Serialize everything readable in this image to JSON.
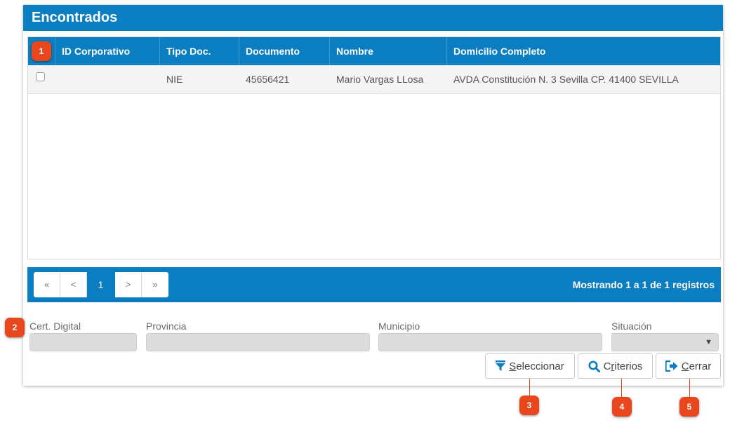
{
  "panel": {
    "title": "Encontrados"
  },
  "table": {
    "columns": [
      "ID Corporativo",
      "Tipo Doc.",
      "Documento",
      "Nombre",
      "Domicilio Completo"
    ],
    "rows": [
      {
        "id_corporativo": "",
        "tipo_doc": "NIE",
        "documento": "45656421",
        "nombre": "Mario Vargas LLosa",
        "domicilio": "AVDA Constitución N. 3 Sevilla CP. 41400 SEVILLA"
      }
    ]
  },
  "pager": {
    "first": "«",
    "prev": "<",
    "current": "1",
    "next": ">",
    "last": "»",
    "info": "Mostrando 1 a 1 de 1 registros"
  },
  "fields": {
    "cert_digital": {
      "label": "Cert. Digital",
      "value": ""
    },
    "provincia": {
      "label": "Provincia",
      "value": ""
    },
    "municipio": {
      "label": "Municipio",
      "value": ""
    },
    "situacion": {
      "label": "Situación",
      "value": ""
    }
  },
  "buttons": {
    "seleccionar": {
      "accel": "S",
      "rest": "eleccionar",
      "icon": "filter-icon"
    },
    "criterios": {
      "first": "C",
      "accel": "r",
      "rest": "iterios",
      "icon": "search-icon"
    },
    "cerrar": {
      "accel": "C",
      "rest": "errar",
      "icon": "sign-out-icon"
    }
  },
  "callouts": [
    "1",
    "2",
    "3",
    "4",
    "5"
  ],
  "colors": {
    "primary": "#0b7ec1",
    "callout": "#e8461d"
  }
}
